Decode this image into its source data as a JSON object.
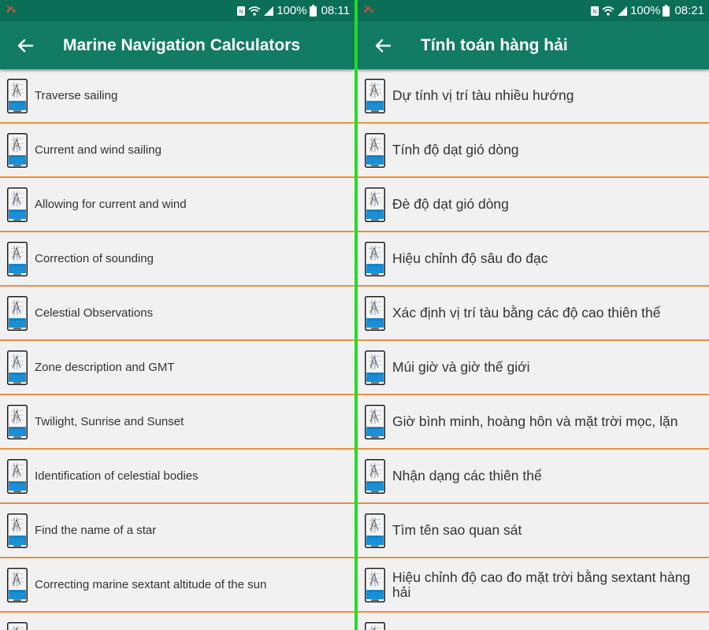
{
  "colors": {
    "statusbar": "#0b6e57",
    "appbar": "#127b63",
    "divider": "#e8903a",
    "separator": "#22dd22",
    "list_bg": "#f1f1f1",
    "call_icon": "#e84c3d"
  },
  "left": {
    "status": {
      "battery": "100%",
      "time": "08:11"
    },
    "appbar": {
      "title": "Marine Navigation Calculators"
    },
    "items": [
      {
        "label": "Traverse sailing"
      },
      {
        "label": "Current and wind sailing"
      },
      {
        "label": "Allowing for current and wind"
      },
      {
        "label": "Correction of sounding"
      },
      {
        "label": "Celestial Observations"
      },
      {
        "label": "Zone description and GMT"
      },
      {
        "label": "Twilight, Sunrise and Sunset"
      },
      {
        "label": "Identification of celestial bodies"
      },
      {
        "label": "Find the name of a star"
      },
      {
        "label": "Correcting marine sextant altitude of the sun"
      }
    ]
  },
  "right": {
    "status": {
      "battery": "100%",
      "time": "08:21"
    },
    "appbar": {
      "title": "Tính toán hàng hải"
    },
    "items": [
      {
        "label": "Dự tính vị trí tàu nhiều hướng"
      },
      {
        "label": "Tính độ dạt gió dòng"
      },
      {
        "label": "Đè độ dạt gió dòng"
      },
      {
        "label": "Hiệu chỉnh độ sâu đo đạc"
      },
      {
        "label": "Xác định vị trí tàu bằng các độ cao thiên thể"
      },
      {
        "label": "Múi giờ và giờ thế giới"
      },
      {
        "label": "Giờ bình minh, hoàng hôn và mặt trời mọc, lặn"
      },
      {
        "label": "Nhận dạng các thiên thể"
      },
      {
        "label": "Tìm tên sao quan sát"
      },
      {
        "label": "Hiệu chỉnh độ cao đo mặt trời bằng sextant hàng hải"
      }
    ]
  }
}
